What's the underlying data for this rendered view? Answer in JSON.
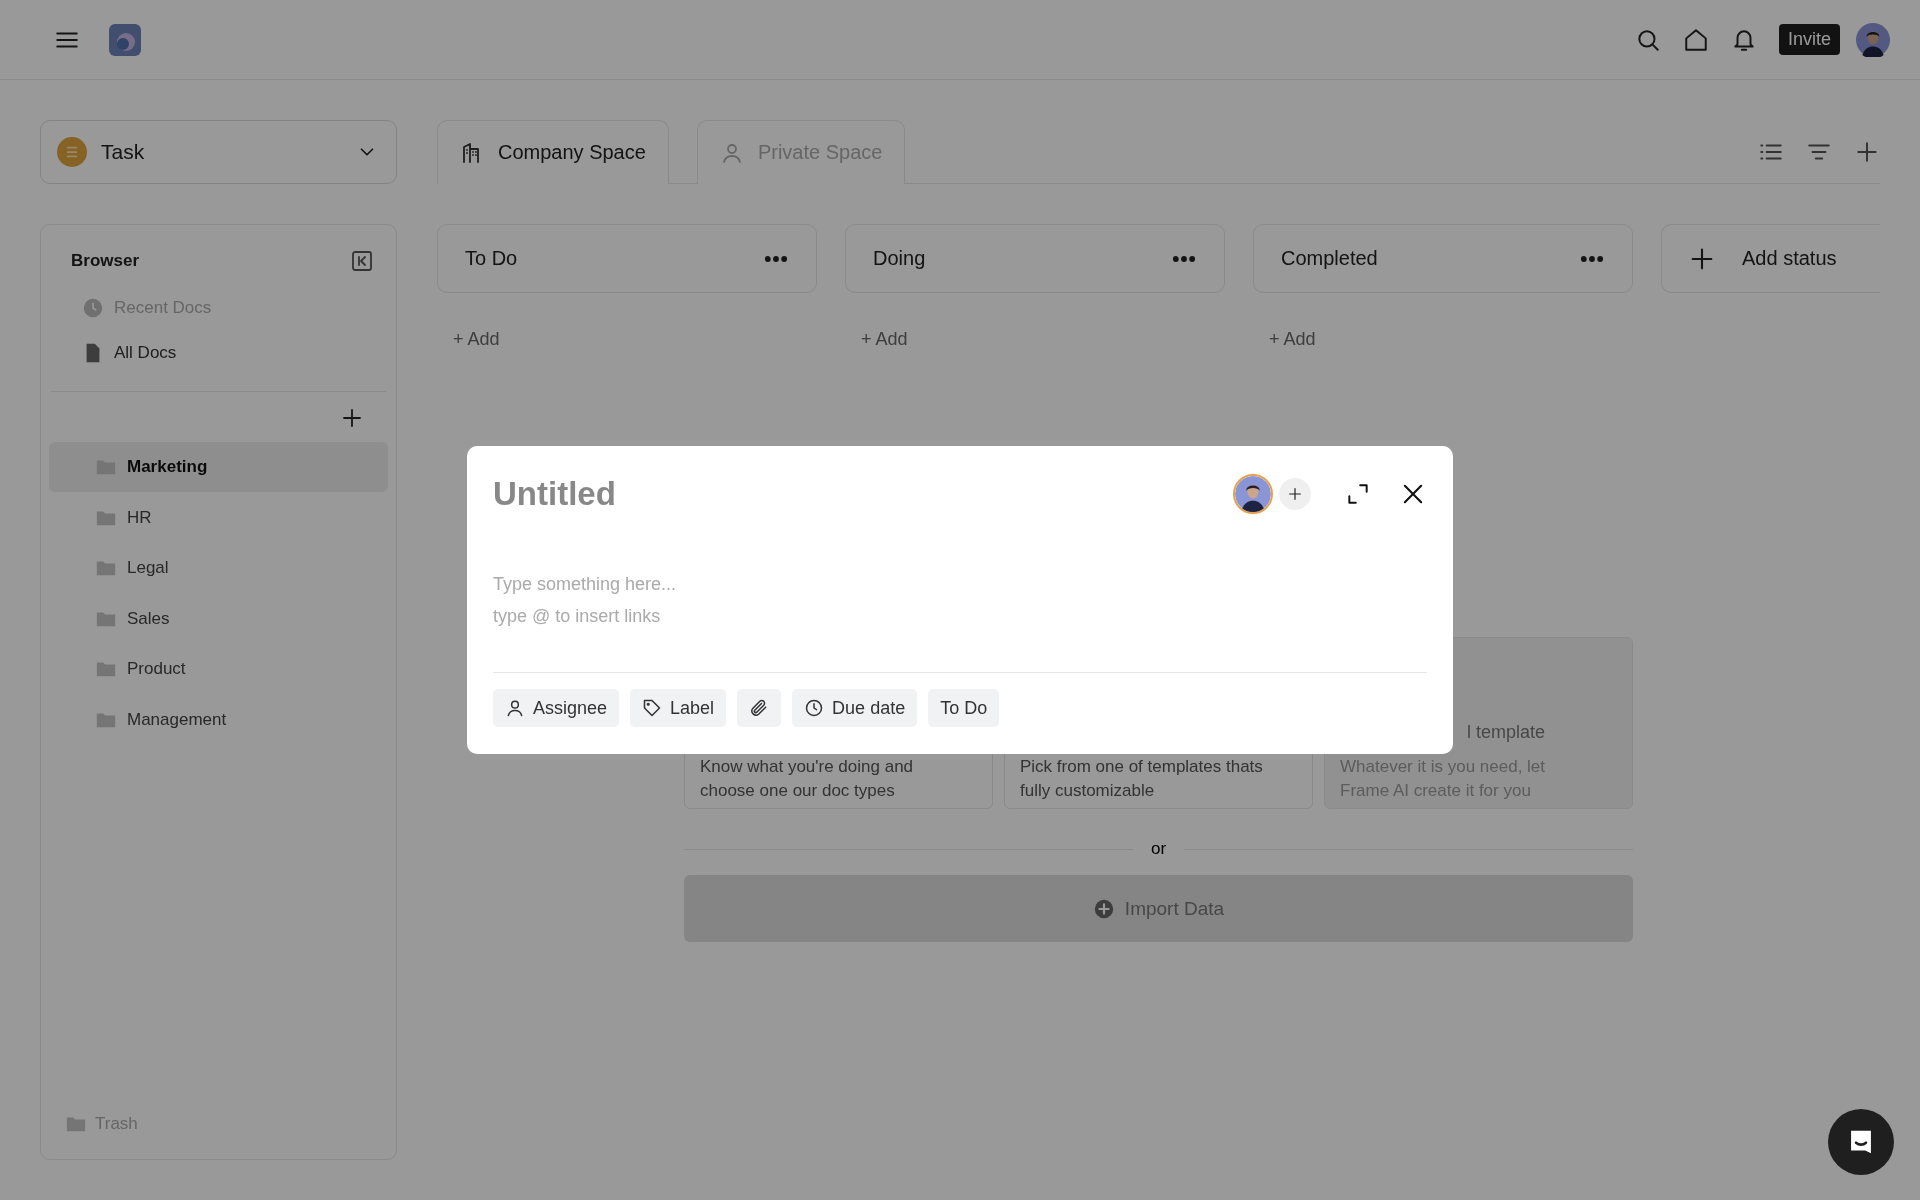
{
  "topbar": {
    "invite": "Invite"
  },
  "task_selector": {
    "label": "Task"
  },
  "space_tabs": [
    {
      "kind": "company",
      "label": "Company Space",
      "selected": true
    },
    {
      "kind": "private",
      "label": "Private Space",
      "selected": false
    }
  ],
  "sidebar": {
    "title": "Browser",
    "nav": [
      {
        "kind": "recent",
        "label": "Recent Docs",
        "disabled": true
      },
      {
        "kind": "docs",
        "label": "All Docs",
        "disabled": false
      }
    ],
    "folders": [
      {
        "label": "Marketing",
        "selected": true
      },
      {
        "label": "HR",
        "selected": false
      },
      {
        "label": "Legal",
        "selected": false
      },
      {
        "label": "Sales",
        "selected": false
      },
      {
        "label": "Product",
        "selected": false
      },
      {
        "label": "Management",
        "selected": false
      }
    ],
    "trash": "Trash"
  },
  "board": {
    "columns": [
      {
        "title": "To Do",
        "add": "+ Add"
      },
      {
        "title": "Doing",
        "add": "+ Add"
      },
      {
        "title": "Completed",
        "add": "+ Add"
      }
    ],
    "add_status": "Add status"
  },
  "start_cards": [
    {
      "description": "Know what you're doing and\nchoose one our doc types",
      "disabled": false
    },
    {
      "description": "Pick from one of templates thats\nfully customizable",
      "disabled": false
    },
    {
      "title": "l template",
      "description": "Whatever it is you need, let\nFrame AI create it for you",
      "disabled": true
    }
  ],
  "divider_text": "or",
  "import_button": "Import Data",
  "modal": {
    "title_placeholder": "Untitled",
    "body_placeholder": "Type something here...\ntype @ to insert links",
    "chips": [
      {
        "kind": "assignee",
        "label": "Assignee"
      },
      {
        "kind": "label",
        "label": "Label"
      },
      {
        "kind": "attachment"
      },
      {
        "kind": "due",
        "label": "Due date"
      },
      {
        "kind": "status",
        "label": "To Do"
      }
    ]
  }
}
